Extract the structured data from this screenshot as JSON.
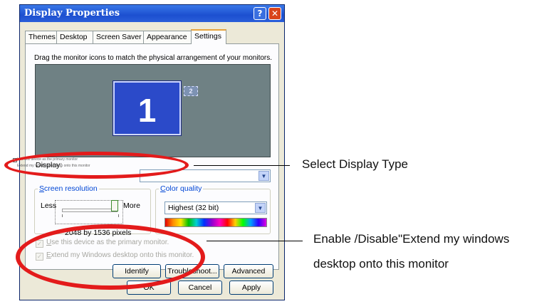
{
  "window": {
    "title": "Display Properties",
    "help_glyph": "?",
    "close_glyph": "✕"
  },
  "tabs": [
    {
      "label": "Themes"
    },
    {
      "label": "Desktop"
    },
    {
      "label": "Screen Saver"
    },
    {
      "label": "Appearance"
    },
    {
      "label": "Settings"
    }
  ],
  "settings": {
    "instruction": "Drag the monitor icons to match the physical arrangement of your monitors.",
    "monitor1_number": "1",
    "monitor2_number": "2",
    "display_label": "Display:",
    "dropdown_arrow": "▼",
    "callout_lines": [
      "Use this device as the primary monitor",
      "Extend my Windows desktop onto this monitor"
    ],
    "screen_resolution": {
      "legend_accel": "S",
      "legend_rest": "creen resolution",
      "less": "Less",
      "more": "More",
      "value": "2048 by 1536 pixels"
    },
    "color_quality": {
      "legend_accel": "C",
      "legend_rest": "olor quality",
      "value": "Highest (32 bit)"
    },
    "checkbox_primary": {
      "accel": "U",
      "rest": "se this device as the primary monitor.",
      "check": "✓"
    },
    "checkbox_extend": {
      "accel": "E",
      "rest": "xtend my Windows desktop onto this monitor.",
      "check": "✓"
    },
    "buttons": {
      "identify": "Identify",
      "troubleshoot": "Troubleshoot...",
      "advanced": "Advanced"
    }
  },
  "footer_buttons": {
    "ok": "OK",
    "cancel": "Cancel",
    "apply": "Apply"
  },
  "annotations": {
    "select_display": "Select Display Type",
    "enable_line1": "Enable /Disable\"Extend my windows",
    "enable_line2": "desktop onto this monitor"
  },
  "colors": {
    "annotation_red": "#e31b1b",
    "titlebar_blue": "#1c4fd0",
    "monitor_blue": "#2b4ac9"
  }
}
